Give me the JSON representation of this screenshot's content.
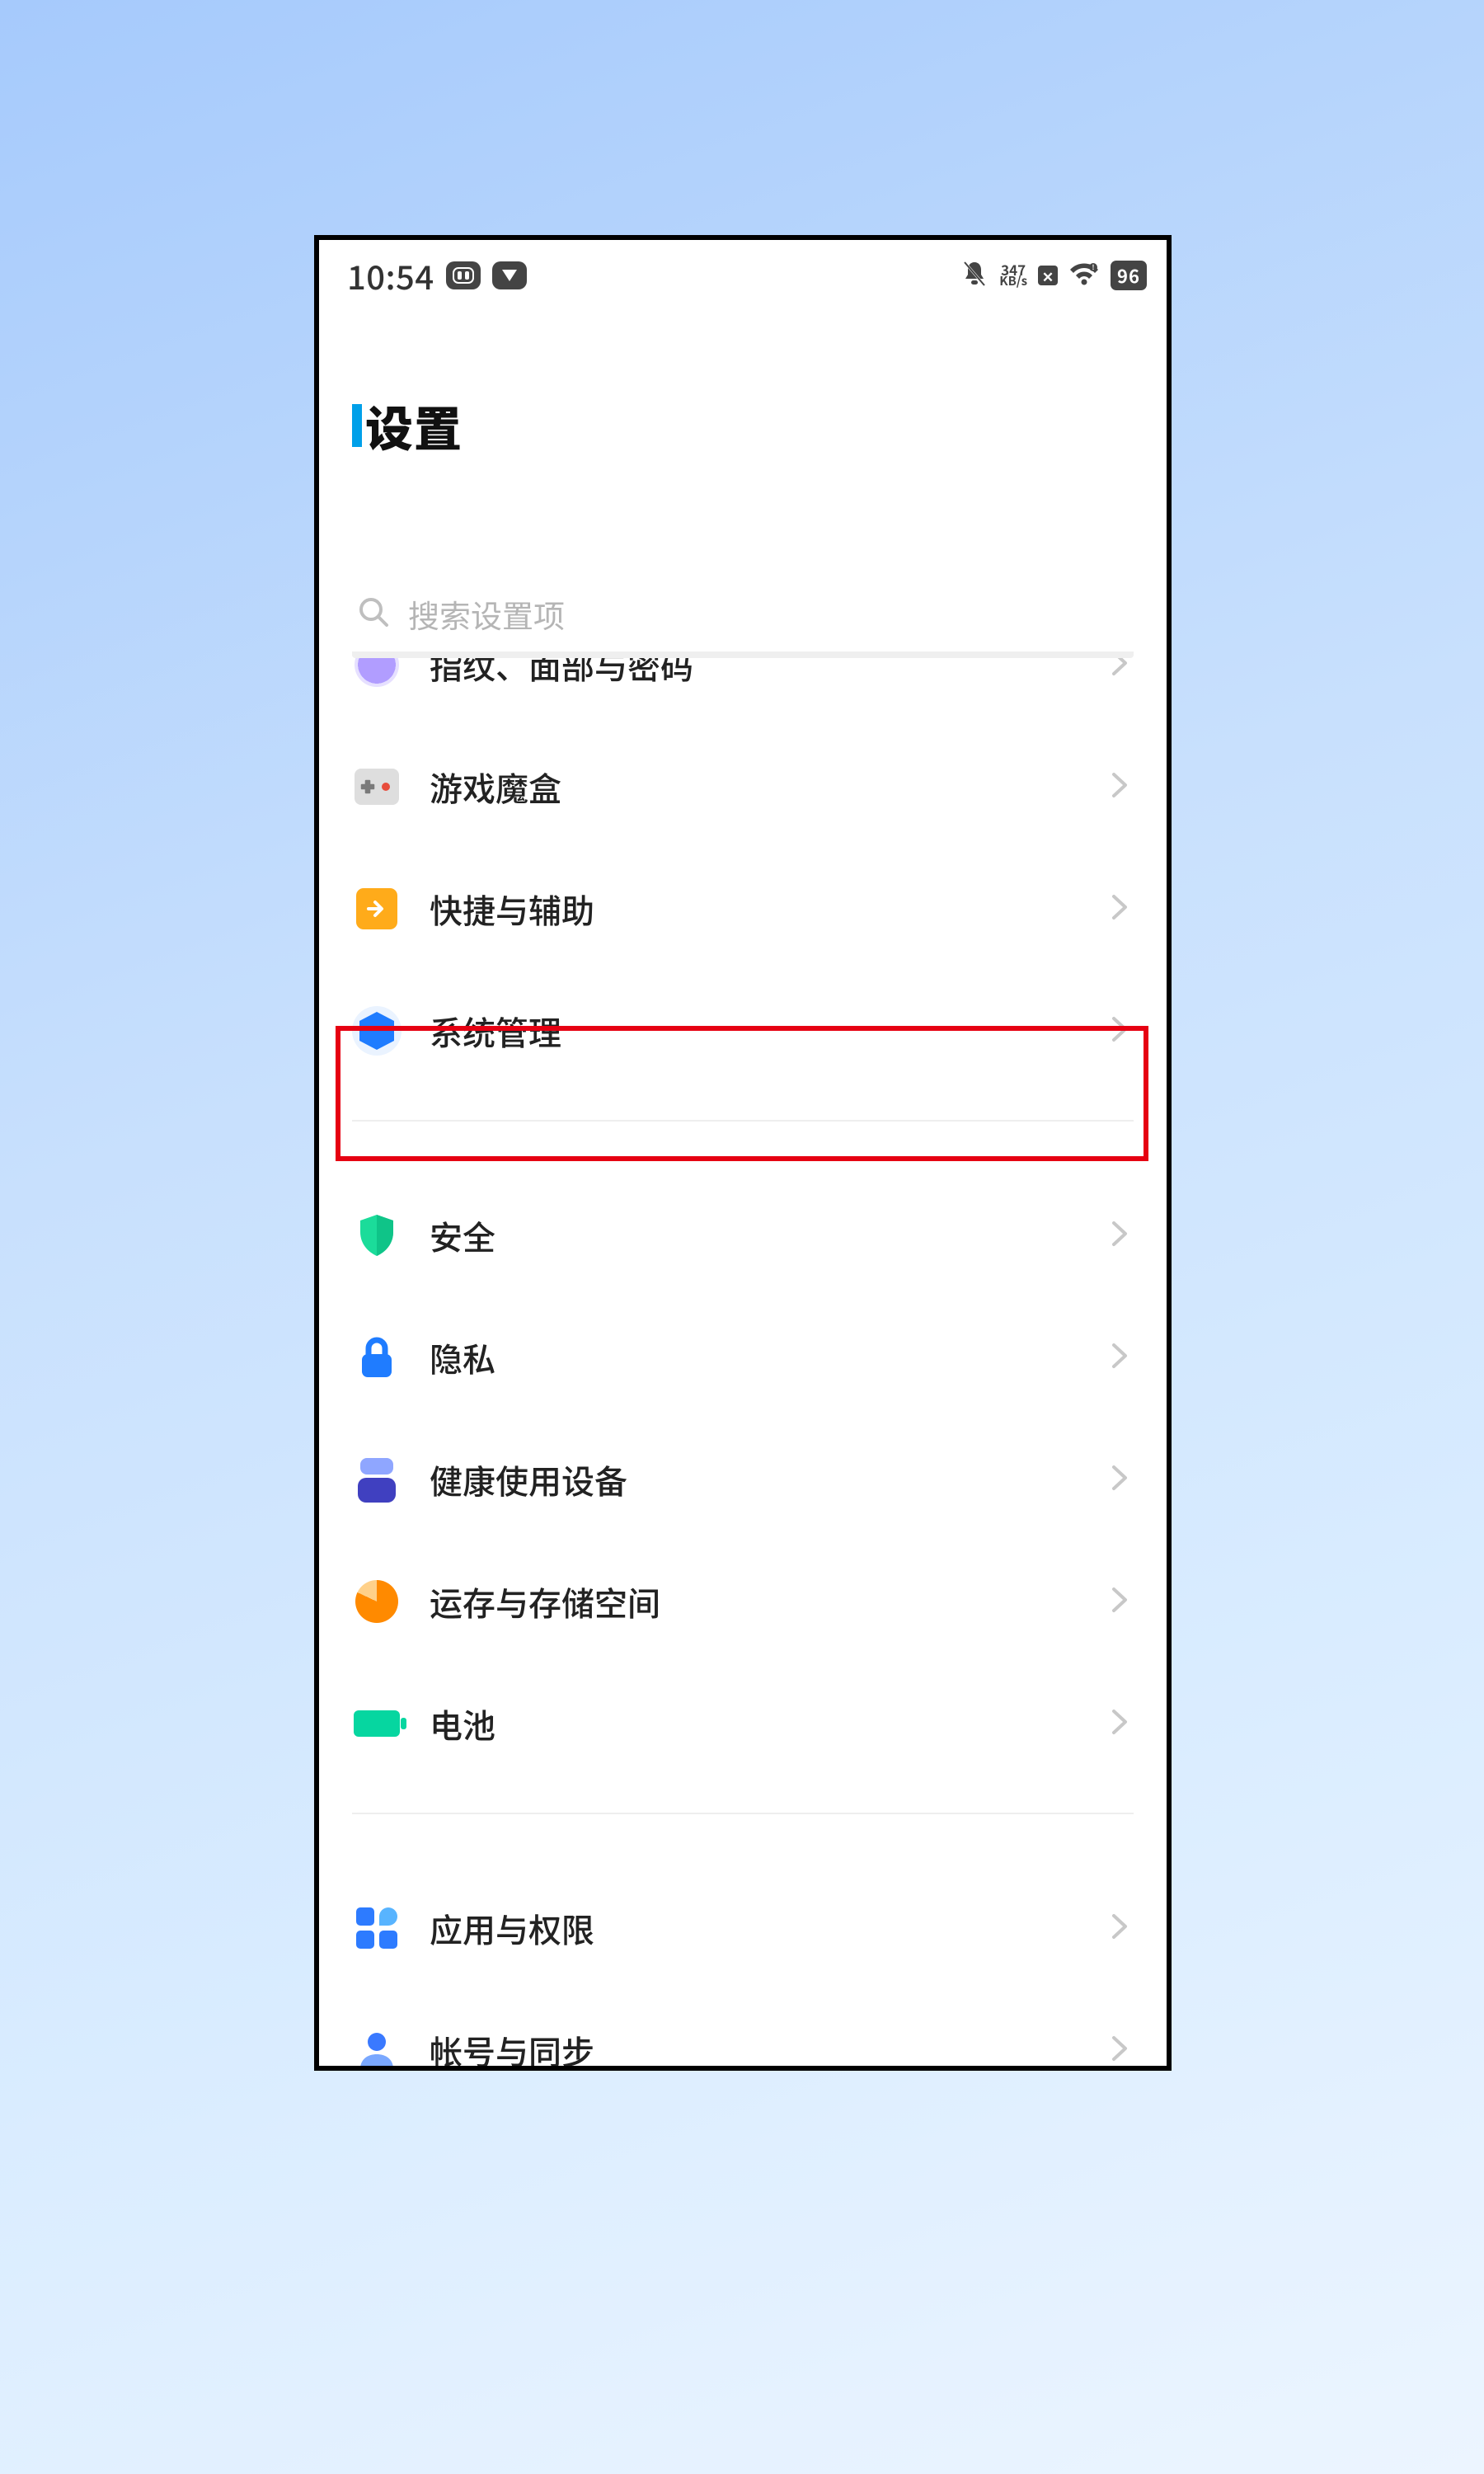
{
  "status": {
    "time": "10:54",
    "net_rate": "347",
    "net_unit": "KB/s",
    "battery": "96"
  },
  "header": {
    "title": "设置"
  },
  "search": {
    "placeholder": "搜索设置项"
  },
  "rows": {
    "biometrics": {
      "label": "指纹、面部与密码"
    },
    "gamebox": {
      "label": "游戏魔盒"
    },
    "shortcut": {
      "label": "快捷与辅助"
    },
    "system": {
      "label": "系统管理"
    },
    "security": {
      "label": "安全"
    },
    "privacy": {
      "label": "隐私"
    },
    "health": {
      "label": "健康使用设备"
    },
    "storage": {
      "label": "运存与存储空间"
    },
    "battery": {
      "label": "电池"
    },
    "apps": {
      "label": "应用与权限"
    },
    "account": {
      "label": "帐号与同步"
    }
  },
  "annotation": {
    "highlighted_row": "system",
    "highlight_color": "#e60012"
  }
}
